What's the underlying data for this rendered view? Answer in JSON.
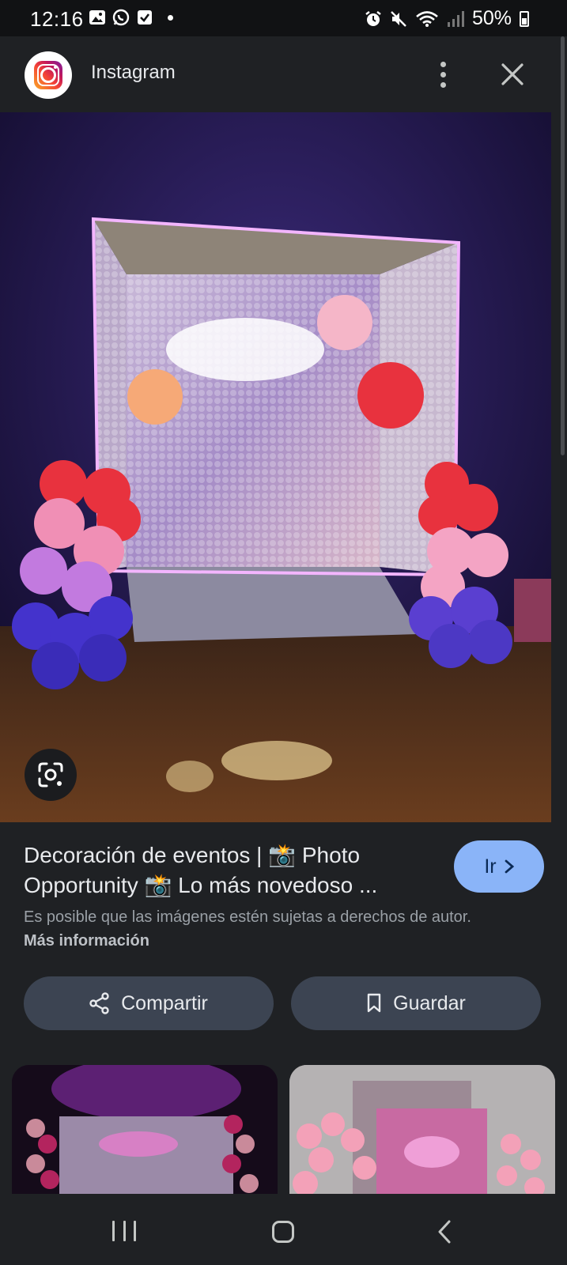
{
  "status_bar": {
    "time": "12:16",
    "battery": "50%",
    "battery_level": 0.5,
    "left_icons": [
      "gallery-icon",
      "whatsapp-icon",
      "checkbox-icon",
      "dot-icon"
    ],
    "right_icons": [
      "alarm-icon",
      "mute-icon",
      "wifi-icon",
      "signal-icon",
      "battery-icon"
    ]
  },
  "header": {
    "app_name": "Instagram",
    "app_icon": "instagram-icon",
    "more_icon": "more-vert-icon",
    "close_icon": "close-icon"
  },
  "image": {
    "lens_icon": "google-lens-icon"
  },
  "result": {
    "title": "Decoración de eventos | 📸 Photo Opportunity 📸 Lo más novedoso ...",
    "go_label": "Ir",
    "notice": "Es posible que las imágenes estén sujetas a derechos de autor.",
    "more_info": "Más información"
  },
  "actions": {
    "share_label": "Compartir",
    "save_label": "Guardar"
  },
  "nav": {
    "recent_icon": "recent-apps-icon",
    "home_icon": "home-icon",
    "back_icon": "back-icon"
  },
  "colors": {
    "background": "#1f2124",
    "accent": "#8ab4f8",
    "pill": "#3c4452"
  }
}
